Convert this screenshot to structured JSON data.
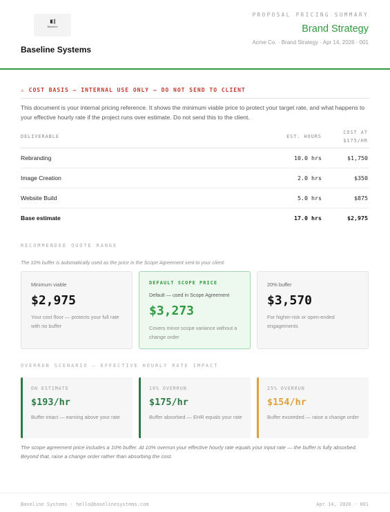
{
  "header": {
    "logo_glyph": "▮▯|",
    "logo_wordmark": "Baseline",
    "company": "Baseline Systems",
    "kicker": "PROPOSAL PRICING SUMMARY",
    "title": "Brand Strategy",
    "meta": "Acme Co. · Brand Strategy · Apr 14, 2026 · 001"
  },
  "warning": "⚠ COST BASIS — INTERNAL USE ONLY — DO NOT SEND TO CLIENT",
  "intro": "This document is your internal pricing reference. It shows the minimum viable price to protect your target rate, and what happens to your effective hourly rate if the project runs over estimate. Do not send this to the client.",
  "table": {
    "col_deliverable": "DELIVERABLE",
    "col_hours": "EST. HOURS",
    "col_cost_line1": "COST AT",
    "col_cost_line2": "$175/HR",
    "rows": [
      {
        "name": "Rebranding",
        "hours": "10.0 hrs",
        "cost": "$1,750"
      },
      {
        "name": "Image Creation",
        "hours": "2.0 hrs",
        "cost": "$350"
      },
      {
        "name": "Website Build",
        "hours": "5.0 hrs",
        "cost": "$875"
      }
    ],
    "total": {
      "name": "Base estimate",
      "hours": "17.0 hrs",
      "cost": "$2,975"
    }
  },
  "quote": {
    "section_label": "RECOMMENDED QUOTE RANGE",
    "note": "The 10% buffer is automatically used as the price in the Scope Agreement sent to your client.",
    "cards": [
      {
        "label": "Minimum viable",
        "price": "$2,975",
        "desc": "Your cost floor — protects your full rate with no buffer"
      },
      {
        "tag": "DEFAULT SCOPE PRICE",
        "sub": "Default — used in Scope Agreement",
        "price": "$3,273",
        "desc": "Covers minor scope variance without a change order"
      },
      {
        "label": "20% buffer",
        "price": "$3,570",
        "desc": "For higher-risk or open-ended engagements"
      }
    ]
  },
  "overrun": {
    "section_label": "OVERRUN SCENARIO — EFFECTIVE HOURLY RATE IMPACT",
    "cards": [
      {
        "head": "ON ESTIMATE",
        "rate": "$193/hr",
        "desc": "Buffer intact — earning above your rate",
        "color": "#2a7a45"
      },
      {
        "head": "10% OVERRUN",
        "rate": "$175/hr",
        "desc": "Buffer absorbed — EHR equals your rate",
        "color": "#2a7a45"
      },
      {
        "head": "25% OVERRUN",
        "rate": "$154/hr",
        "desc": "Buffer exceeded — raise a change order",
        "color": "#e0a03a"
      }
    ],
    "closing": "The scope agreement price includes a 10% buffer. At 10% overrun your effective hourly rate equals your input rate — the buffer is fully absorbed. Beyond that, raise a change order rather than absorbing the cost."
  },
  "footer": {
    "left": "Baseline Systems · hello@baselinesystems.com",
    "right": "Apr 14, 2026 · 001"
  },
  "colors": {
    "accent": "#2e9a3e",
    "warning": "#c0392b",
    "on_track": "#2a7a45",
    "exceeded": "#e0a03a"
  }
}
